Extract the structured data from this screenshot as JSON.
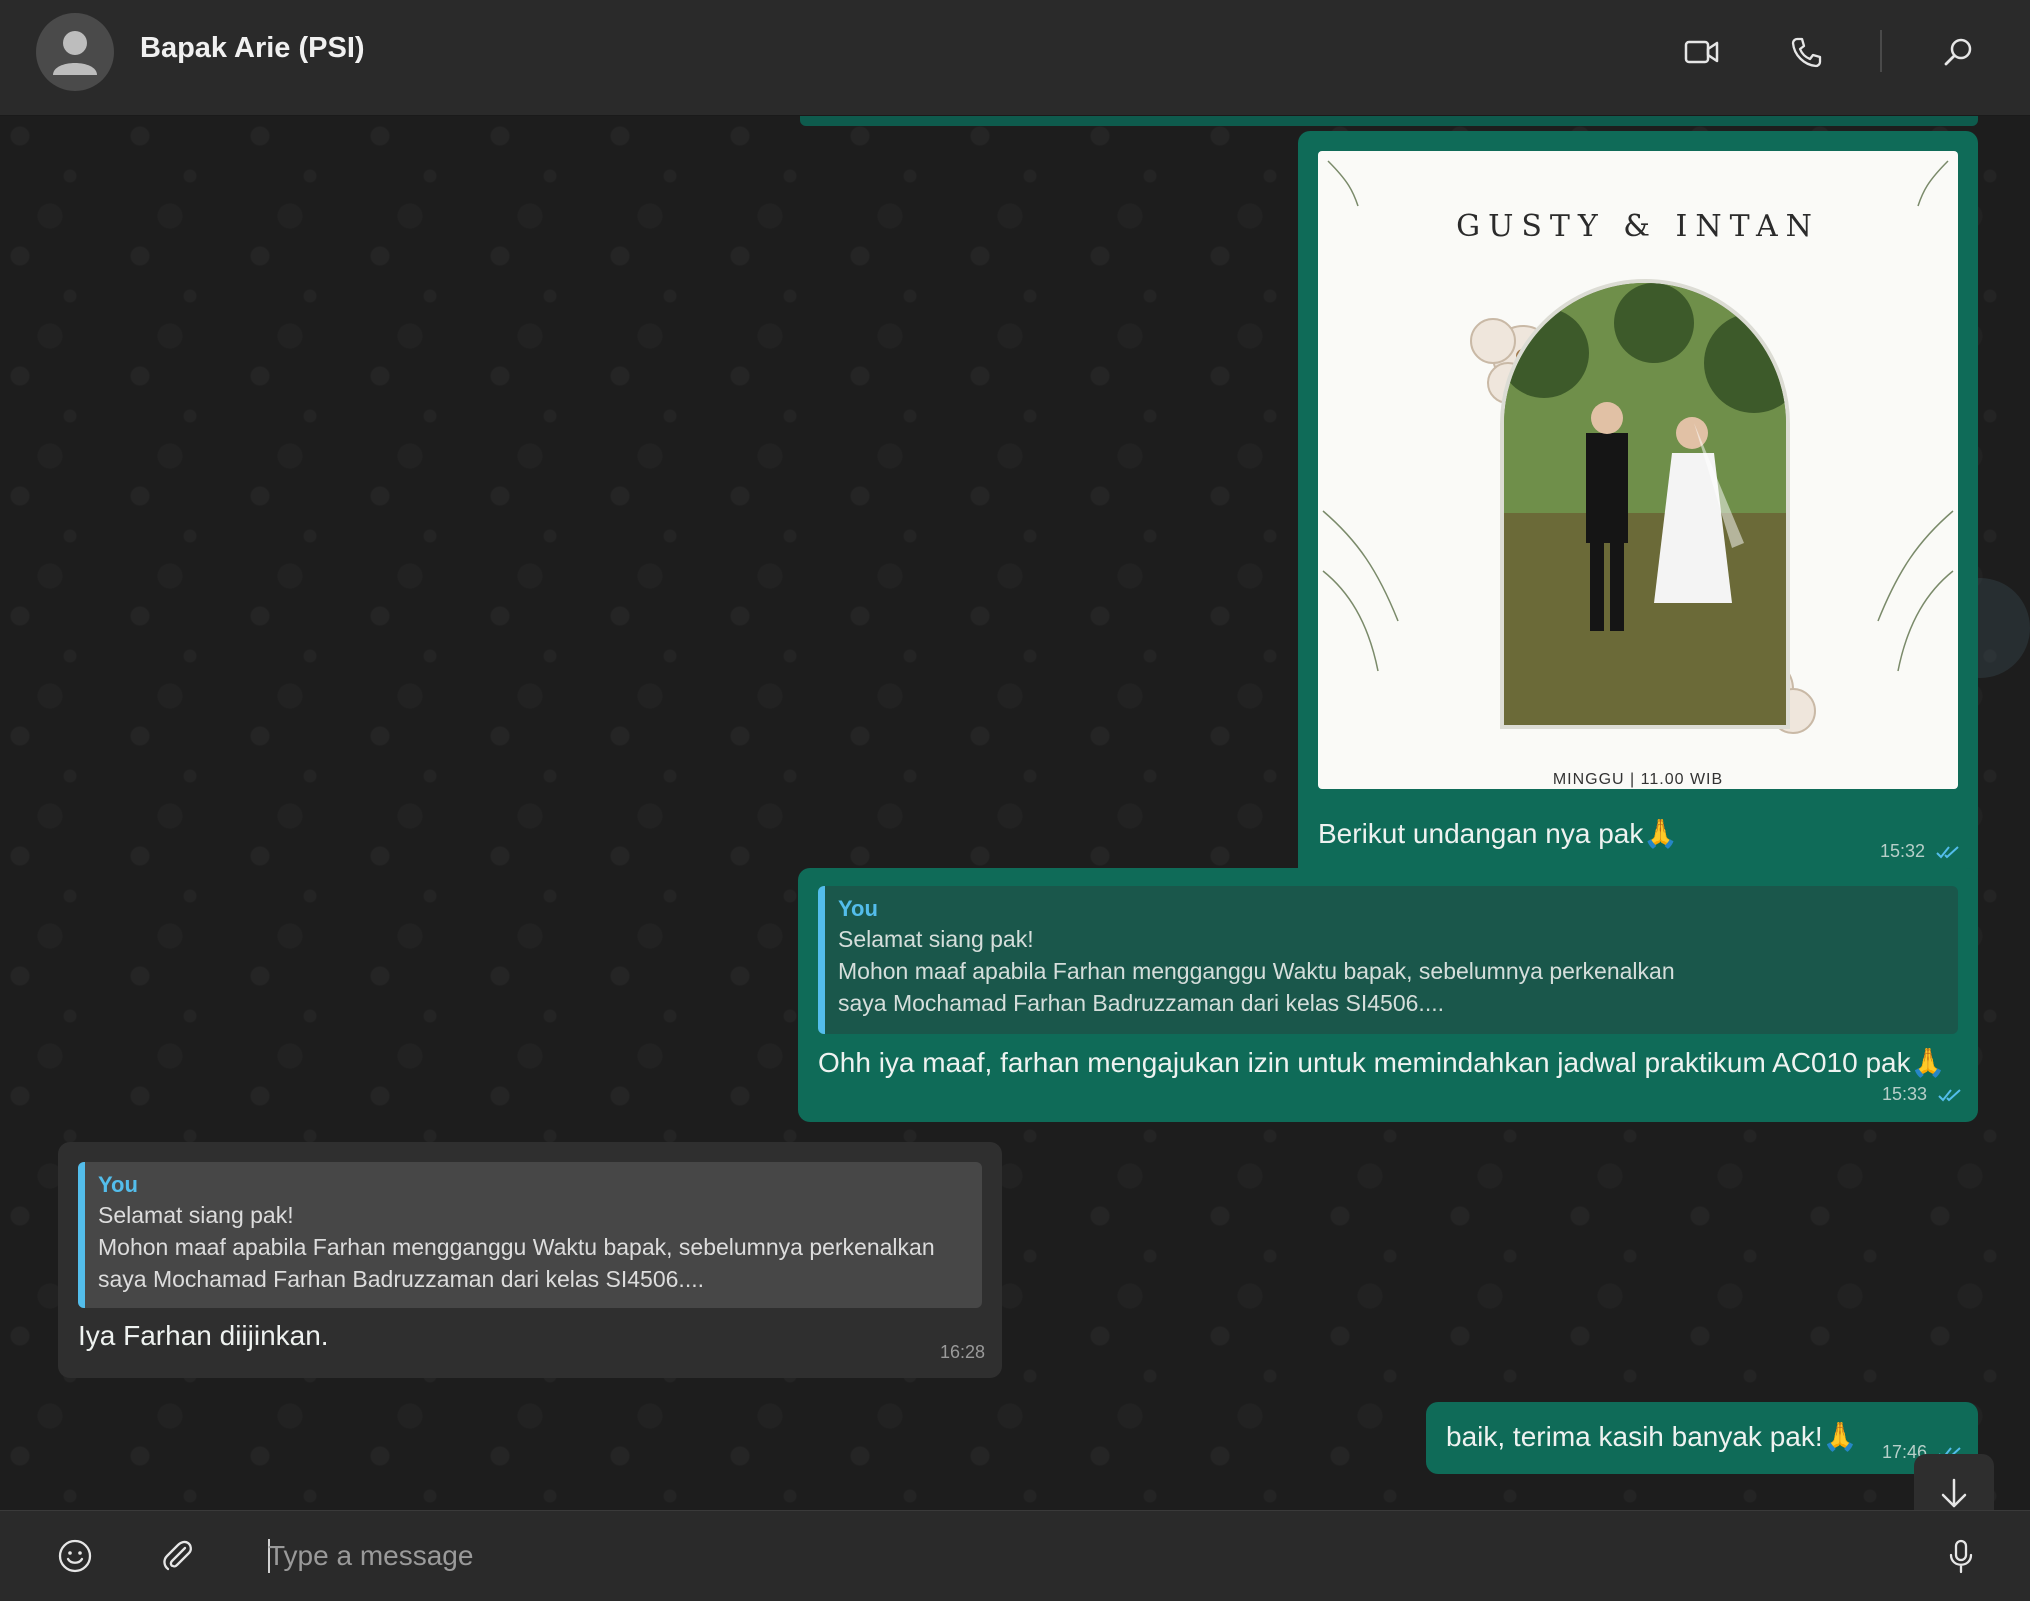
{
  "header": {
    "contact_name": "Bapak Arie (PSI)",
    "icons": [
      "avatar",
      "video-call-icon",
      "voice-call-icon",
      "search-icon"
    ]
  },
  "messages": [
    {
      "type": "image",
      "direction": "outgoing",
      "image": {
        "title": "GUSTY & INTAN",
        "footer": "MINGGU | 11.00 WIB"
      },
      "caption": "Berikut undangan nya pak🙏",
      "time": "15:32",
      "status": "read"
    },
    {
      "type": "reply",
      "direction": "outgoing",
      "quote": {
        "author": "You",
        "lines": [
          "Selamat siang pak!",
          "Mohon maaf apabila Farhan mengganggu Waktu bapak, sebelumnya perkenalkan",
          "saya Mochamad Farhan Badruzzaman dari kelas SI4506...."
        ]
      },
      "text": "Ohh iya maaf, farhan mengajukan izin untuk memindahkan jadwal praktikum AC010 pak🙏",
      "time": "15:33",
      "status": "read"
    },
    {
      "type": "reply",
      "direction": "incoming",
      "quote": {
        "author": "You",
        "lines": [
          "Selamat siang pak!",
          "Mohon maaf apabila Farhan mengganggu Waktu bapak, sebelumnya perkenalkan",
          "saya Mochamad Farhan Badruzzaman dari kelas SI4506...."
        ]
      },
      "text": "Iya Farhan diijinkan.",
      "time": "16:28"
    },
    {
      "type": "text",
      "direction": "outgoing",
      "text": "baik, terima kasih banyak pak!🙏",
      "time": "17:46",
      "status": "read"
    }
  ],
  "composer": {
    "placeholder": "Type a message",
    "icons": [
      "emoji-icon",
      "attach-icon",
      "microphone-icon"
    ]
  },
  "colors": {
    "outgoing_bubble": "#0f6b58",
    "incoming_bubble": "#2f2f2f",
    "quote_accent": "#53bdeb",
    "read_ticks": "#53bdeb"
  }
}
